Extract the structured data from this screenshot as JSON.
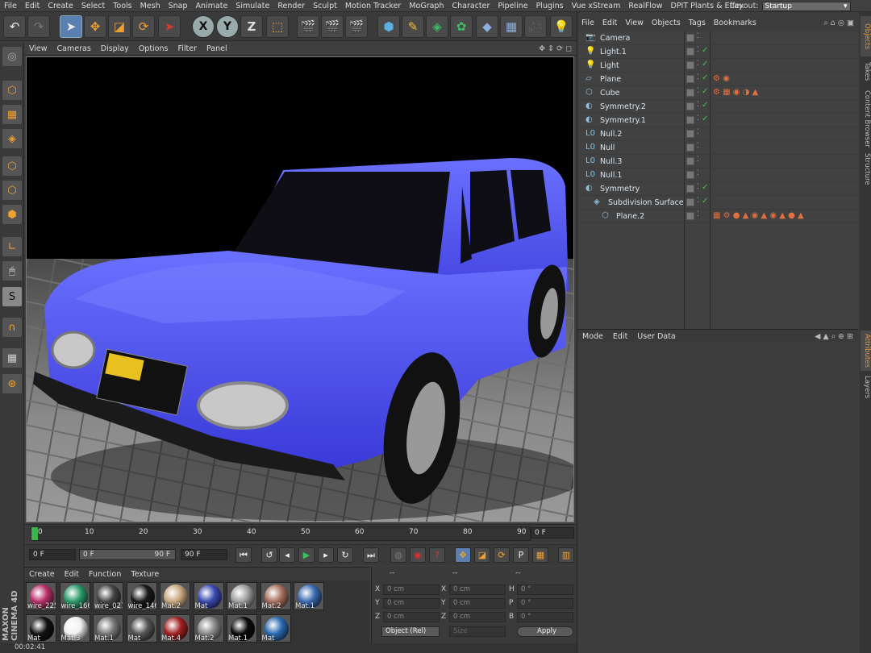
{
  "menu": [
    "File",
    "Edit",
    "Create",
    "Select",
    "Tools",
    "Mesh",
    "Snap",
    "Animate",
    "Simulate",
    "Render",
    "Sculpt",
    "Motion Tracker",
    "MoGraph",
    "Character",
    "Pipeline",
    "Plugins",
    "Vue xStream",
    "RealFlow",
    "DPIT Plants & Effex"
  ],
  "layout": {
    "label": "Layout:",
    "value": "Startup"
  },
  "viewport_menu": [
    "View",
    "Cameras",
    "Display",
    "Options",
    "Filter",
    "Panel"
  ],
  "timeline": {
    "ticks": [
      "0",
      "10",
      "20",
      "30",
      "40",
      "50",
      "60",
      "70",
      "80",
      "90"
    ],
    "current_frame": "0 F"
  },
  "transport": {
    "start": "0 F",
    "range_start": "0 F",
    "range_end": "90 F",
    "end": "90 F"
  },
  "material_menu": [
    "Create",
    "Edit",
    "Function",
    "Texture"
  ],
  "materials": [
    {
      "name": "wire_225",
      "color": "#b8306a"
    },
    {
      "name": "wire_166",
      "color": "#2a9a6a"
    },
    {
      "name": "wire_027",
      "color": "#444444"
    },
    {
      "name": "wire_146",
      "color": "#1a1a1a"
    },
    {
      "name": "Mat.2",
      "color": "#c8a880"
    },
    {
      "name": "Mat",
      "color": "#3a4ab0"
    },
    {
      "name": "Mat.1",
      "color": "#a0a0a0"
    },
    {
      "name": "Mat.2",
      "color": "#a87060"
    },
    {
      "name": "Mat.1",
      "color": "#3a6ab0"
    },
    {
      "name": "Mat",
      "color": "#111111"
    },
    {
      "name": "Mat.3",
      "color": "#f0f0f0"
    },
    {
      "name": "Mat.1",
      "color": "#777777"
    },
    {
      "name": "Mat",
      "color": "#555555"
    },
    {
      "name": "Mat.4",
      "color": "#a02020"
    },
    {
      "name": "Mat.2",
      "color": "#888888"
    },
    {
      "name": "Mat.1",
      "color": "#0a0a0a"
    },
    {
      "name": "Mat",
      "color": "#2a6ab0"
    }
  ],
  "coords": {
    "header_left": "--",
    "header_mid": "--",
    "header_right": "--",
    "x": "0 cm",
    "y": "0 cm",
    "z": "0 cm",
    "sx": "0 cm",
    "sy": "0 cm",
    "sz": "0 cm",
    "h": "0 °",
    "p": "0 °",
    "b": "0 °",
    "mode": "Object (Rel)",
    "size": "Size",
    "apply": "Apply"
  },
  "status": "00:02:41",
  "maxon": "MAXON CINEMA 4D",
  "object_menu": [
    "File",
    "Edit",
    "View",
    "Objects",
    "Tags",
    "Bookmarks"
  ],
  "objects": [
    {
      "name": "Camera",
      "icon": "📷",
      "indent": 0,
      "check": false,
      "tags": ""
    },
    {
      "name": "Light.1",
      "icon": "💡",
      "indent": 0,
      "check": true,
      "tags": ""
    },
    {
      "name": "Light",
      "icon": "💡",
      "indent": 0,
      "check": true,
      "tags": ""
    },
    {
      "name": "Plane",
      "icon": "▱",
      "indent": 0,
      "check": true,
      "tags": "⚙ ◉"
    },
    {
      "name": "Cube",
      "icon": "⬡",
      "indent": 0,
      "check": true,
      "tags": "⚙ ▦ ◉ ◑ ▲"
    },
    {
      "name": "Symmetry.2",
      "icon": "◐",
      "indent": 0,
      "check": true,
      "tags": ""
    },
    {
      "name": "Symmetry.1",
      "icon": "◐",
      "indent": 0,
      "check": true,
      "tags": ""
    },
    {
      "name": "Null.2",
      "icon": "L0",
      "indent": 0,
      "check": false,
      "tags": ""
    },
    {
      "name": "Null",
      "icon": "L0",
      "indent": 0,
      "check": false,
      "tags": ""
    },
    {
      "name": "Null.3",
      "icon": "L0",
      "indent": 0,
      "check": false,
      "tags": ""
    },
    {
      "name": "Null.1",
      "icon": "L0",
      "indent": 0,
      "check": false,
      "tags": ""
    },
    {
      "name": "Symmetry",
      "icon": "◐",
      "indent": 0,
      "check": true,
      "tags": ""
    },
    {
      "name": "Subdivision Surface",
      "icon": "◈",
      "indent": 1,
      "check": true,
      "tags": ""
    },
    {
      "name": "Plane.2",
      "icon": "⬡",
      "indent": 2,
      "check": false,
      "tags": "▦ ⚙ ● ▲ ◉ ▲ ◉ ▲ ● ▲"
    }
  ],
  "attributes_menu": [
    "Mode",
    "Edit",
    "User Data"
  ],
  "right_tabs": [
    "Objects",
    "Takes",
    "Content Browser",
    "Structure"
  ],
  "right_tabs_lower": [
    "Attributes",
    "Layers"
  ]
}
